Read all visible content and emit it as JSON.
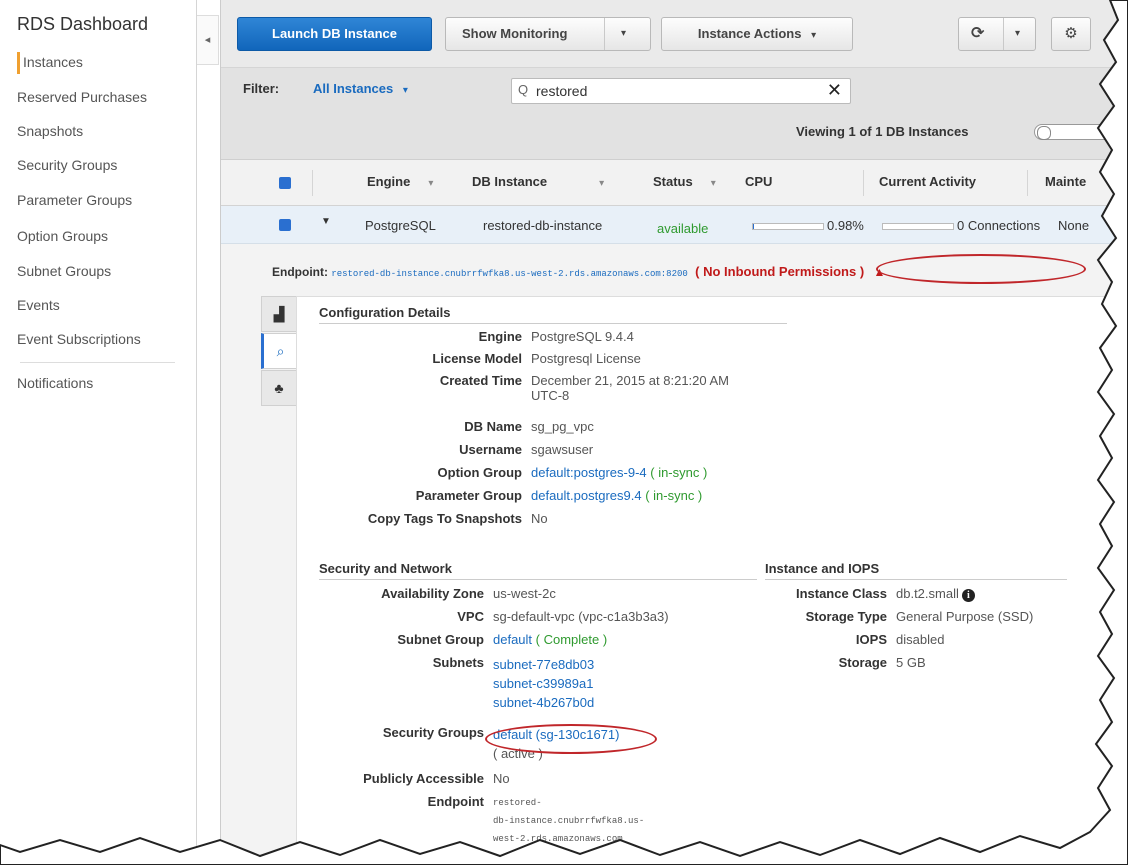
{
  "sidebar": {
    "title": "RDS Dashboard",
    "collapse_icon": "chevron-left-icon",
    "items": [
      {
        "label": "Instances",
        "active": true
      },
      {
        "label": "Reserved Purchases"
      },
      {
        "label": "Snapshots"
      },
      {
        "label": "Security Groups"
      },
      {
        "label": "Parameter Groups"
      },
      {
        "label": "Option Groups"
      },
      {
        "label": "Subnet Groups"
      },
      {
        "label": "Events"
      },
      {
        "label": "Event Subscriptions"
      },
      {
        "label": "Notifications"
      }
    ]
  },
  "toolbar": {
    "launch_label": "Launch DB Instance",
    "monitoring_label": "Show Monitoring",
    "actions_label": "Instance Actions",
    "refresh_icon": "refresh-icon",
    "settings_icon": "gear-icon"
  },
  "filter": {
    "label": "Filter:",
    "selected": "All Instances",
    "search_value": "restored",
    "viewing": "Viewing 1 of 1 DB Instances"
  },
  "table": {
    "headers": [
      "Engine",
      "DB Instance",
      "Status",
      "CPU",
      "Current Activity",
      "Mainte"
    ],
    "row": {
      "engine": "PostgreSQL",
      "db_instance": "restored-db-instance",
      "status": "available",
      "cpu": "0.98%",
      "cpu_fraction": 0.0098,
      "activity": "0 Connections",
      "maintenance": "None"
    }
  },
  "endpoint": {
    "label": "Endpoint:",
    "value": "restored-db-instance.cnubrrfwfka8.us-west-2.rds.amazonaws.com:8200",
    "warning": "( No Inbound Permissions )"
  },
  "colors": {
    "accent": "#1a6bbf",
    "primary_button": "#1166bb",
    "warning": "#c01a1a",
    "status_green": "#2f9a2f",
    "active_bar": "#f0a030"
  },
  "config": {
    "title": "Configuration Details",
    "engine_k": "Engine",
    "engine_v": "PostgreSQL 9.4.4",
    "license_k": "License Model",
    "license_v": "Postgresql License",
    "created_k": "Created Time",
    "created_v1": "December 21, 2015 at 8:21:20 AM",
    "created_v2": "UTC-8",
    "dbname_k": "DB Name",
    "dbname_v": "sg_pg_vpc",
    "username_k": "Username",
    "username_v": "sgawsuser",
    "optgroup_k": "Option Group",
    "optgroup_v": "default:postgres-9-4",
    "optgroup_s": "( in-sync )",
    "paramgroup_k": "Parameter Group",
    "paramgroup_v": "default.postgres9.4",
    "paramgroup_s": "( in-sync )",
    "copytags_k": "Copy Tags To Snapshots",
    "copytags_v": "No"
  },
  "network": {
    "title": "Security and Network",
    "az_k": "Availability Zone",
    "az_v": "us-west-2c",
    "vpc_k": "VPC",
    "vpc_v": "sg-default-vpc (vpc-c1a3b3a3)",
    "subnetgroup_k": "Subnet Group",
    "subnetgroup_v": "default",
    "subnetgroup_s": "( Complete )",
    "subnets_k": "Subnets",
    "subnets": [
      "subnet-77e8db03",
      "subnet-c39989a1",
      "subnet-4b267b0d"
    ],
    "secgroups_k": "Security Groups",
    "secgroups_v": "default (sg-130c1671)",
    "secgroups_s": "( active )",
    "public_k": "Publicly Accessible",
    "public_v": "No",
    "endpoint_k": "Endpoint",
    "endpoint_lines": [
      "restored-",
      "db-instance.cnubrrfwfka8.us-",
      "west-2.rds.amazonaws.com"
    ]
  },
  "iops": {
    "title": "Instance and IOPS",
    "class_k": "Instance Class",
    "class_v": "db.t2.small",
    "storage_type_k": "Storage Type",
    "storage_type_v": "General Purpose (SSD)",
    "iops_k": "IOPS",
    "iops_v": "disabled",
    "storage_k": "Storage",
    "storage_v": "5 GB"
  }
}
